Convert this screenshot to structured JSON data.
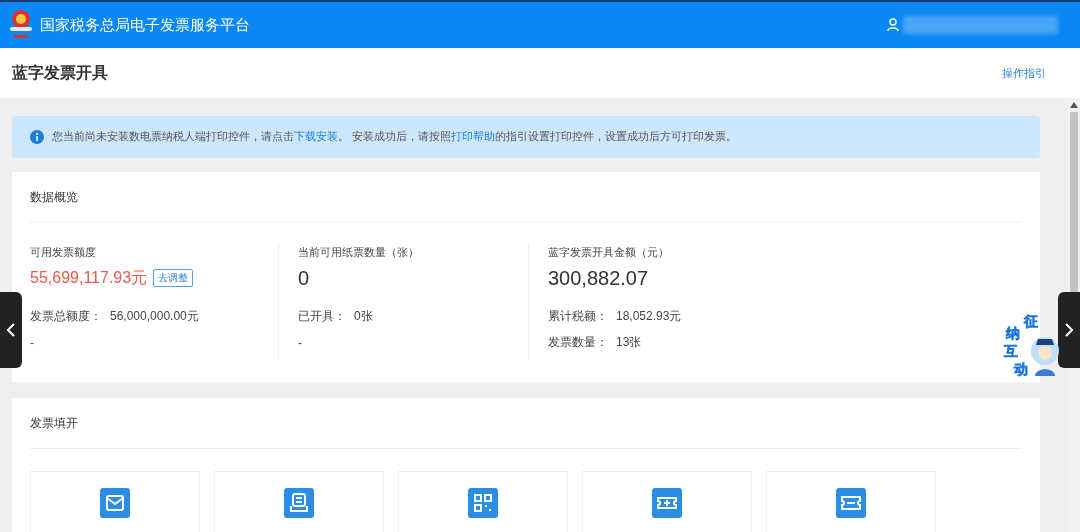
{
  "header": {
    "title": "国家税务总局电子发票服务平台"
  },
  "page": {
    "title": "蓝字发票开具",
    "guide_link": "操作指引"
  },
  "notice": {
    "segments": [
      {
        "kind": "text",
        "text": "您当前尚未安装数电票纳税人端打印控件，请点击"
      },
      {
        "kind": "link",
        "text": "下载安装"
      },
      {
        "kind": "text",
        "text": "。 安装成功后，请按照"
      },
      {
        "kind": "link",
        "text": "打印帮助"
      },
      {
        "kind": "text",
        "text": "的指引设置打印控件，设置成功后方可打印发票。"
      }
    ]
  },
  "overview": {
    "title": "数据概览",
    "stats": [
      {
        "label": "可用发票额度",
        "value": "55,699,117.93元",
        "highlight": true,
        "action": "去调整",
        "details": [
          {
            "label": "发票总额度：",
            "value": "56,000,000.00元"
          },
          {
            "label": "-"
          }
        ]
      },
      {
        "label": "当前可用纸票数量（张）",
        "value": "0",
        "highlight": false,
        "details": [
          {
            "label": "已开具：",
            "value": "0张"
          },
          {
            "label": "-"
          }
        ]
      },
      {
        "label": "蓝字发票开具金额（元）",
        "value": "300,882.07",
        "highlight": false,
        "details": [
          {
            "label": "累计税额：",
            "value": "18,052.93元"
          },
          {
            "label": "发票数量：",
            "value": "13张"
          }
        ]
      }
    ]
  },
  "issue": {
    "title": "发票填开",
    "tiles": [
      {
        "kind": "envelope"
      },
      {
        "kind": "receipt"
      },
      {
        "kind": "qr"
      },
      {
        "kind": "ticket-plus"
      },
      {
        "kind": "ticket"
      }
    ]
  },
  "assistant": {
    "chars": [
      "征",
      "纳",
      "互",
      "动"
    ]
  }
}
